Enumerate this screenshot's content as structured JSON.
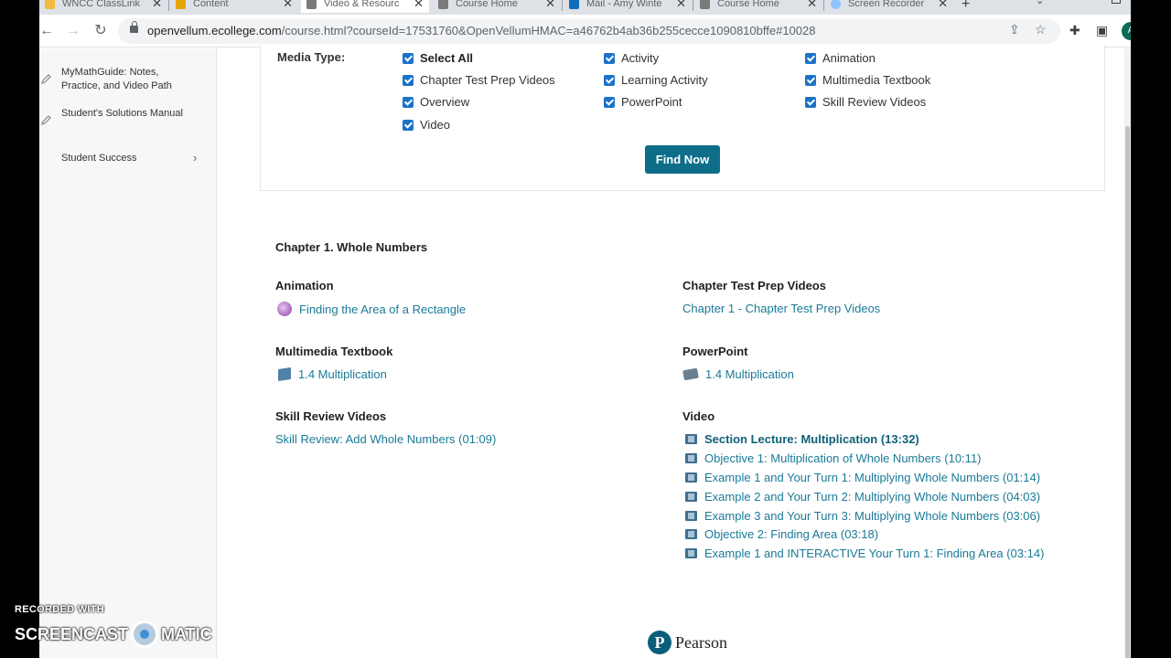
{
  "browser": {
    "tabs": [
      {
        "label": "WNCC ClassLink",
        "color": "#f6b93b"
      },
      {
        "label": "Content",
        "color": "#e5a50a"
      },
      {
        "label": "Video & Resourc",
        "color": "#7a7a7a"
      },
      {
        "label": "Course Home",
        "color": "#7a7a7a"
      },
      {
        "label": "Mail - Amy Winte",
        "color": "#0f6cbd"
      },
      {
        "label": "Course Home",
        "color": "#7a7a7a"
      },
      {
        "label": "Screen Recorder",
        "color": "#8ec5ff"
      }
    ],
    "new_tab_icon": "+",
    "url_host": "openvellum.ecollege.com",
    "url_path": "/course.html?courseId=17531760&OpenVellumHMAC=a46762b4ab36b255cecce1090810bffe#10028",
    "avatar_letter": "A"
  },
  "sidebar": {
    "items": [
      {
        "label": "MyMathGuide: Notes, Practice, and Video Path"
      },
      {
        "label": "Student's Solutions Manual"
      },
      {
        "label": "Student Success"
      }
    ]
  },
  "filter": {
    "media_type_label": "Media Type:",
    "options": {
      "select_all": "Select All",
      "activity": "Activity",
      "animation": "Animation",
      "chapter_test_prep": "Chapter Test Prep Videos",
      "learning_activity": "Learning Activity",
      "multimedia_textbook": "Multimedia Textbook",
      "overview": "Overview",
      "powerpoint": "PowerPoint",
      "skill_review": "Skill Review Videos",
      "video": "Video"
    },
    "find_now": "Find Now"
  },
  "results": {
    "chapter": "Chapter 1. Whole Numbers",
    "animation": {
      "title": "Animation",
      "items": [
        "Finding the Area of a Rectangle"
      ]
    },
    "chapter_test_prep": {
      "title": "Chapter Test Prep Videos",
      "items": [
        "Chapter 1 - Chapter Test Prep Videos"
      ]
    },
    "multimedia_textbook": {
      "title": "Multimedia Textbook",
      "items": [
        "1.4 Multiplication"
      ]
    },
    "powerpoint": {
      "title": "PowerPoint",
      "items": [
        "1.4 Multiplication"
      ]
    },
    "skill_review": {
      "title": "Skill Review Videos",
      "items": [
        "Skill Review: Add Whole Numbers (01:09)"
      ]
    },
    "video": {
      "title": "Video",
      "items": [
        "Section Lecture: Multiplication (13:32)",
        "Objective 1: Multiplication of Whole Numbers (10:11)",
        "Example 1 and Your Turn 1: Multiplying Whole Numbers (01:14)",
        "Example 2 and Your Turn 2: Multiplying Whole Numbers (04:03)",
        "Example 3 and Your Turn 3: Multiplying Whole Numbers (03:06)",
        "Objective 2: Finding Area (03:18)",
        "Example 1 and INTERACTIVE Your Turn 1: Finding Area (03:14)"
      ]
    }
  },
  "footer": {
    "brand": "Pearson",
    "logo_letter": "P"
  },
  "watermark": {
    "line1": "RECORDED WITH",
    "left": "SCREENCAST",
    "right": "MATIC"
  }
}
